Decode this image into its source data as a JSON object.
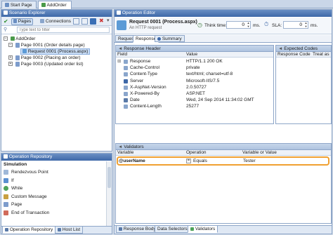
{
  "doc_tabs": [
    {
      "label": "Start Page"
    },
    {
      "label": "AddOrder"
    }
  ],
  "scenario": {
    "title": "Scenario Explorer",
    "pages_label": "Pages",
    "connections_label": "Connections",
    "filter_placeholder": "Type text to filter",
    "tree": {
      "root": "AddOrder",
      "page1": "Page 0001 (Order details page)",
      "request1": "Request 0001 (Process.aspx)",
      "page2": "Page 0002 (Placing an order)",
      "page3": "Page 0003 (Updated order list)"
    }
  },
  "repository": {
    "title": "Operation Repository",
    "group": "Simulation",
    "items": [
      "Rendezvous Point",
      "If",
      "While",
      "Custom Message",
      "Page",
      "End of Transaction"
    ],
    "tabs": [
      "Operation Repository",
      "Host List"
    ]
  },
  "editor": {
    "title": "Operation Editor",
    "request_title": "Request 0001 (Process.aspx)",
    "request_sub": "An HTTP request",
    "think_time_label": "Think time:",
    "think_time_value": "0",
    "think_unit": "ms.",
    "sla_label": "SLA:",
    "sla_value": "0",
    "sla_unit": "ms.",
    "tabs": {
      "request": "Request",
      "response": "Response",
      "summary": "Summary"
    }
  },
  "response_header": {
    "title": "Response Header",
    "col_field": "Field",
    "col_value": "Value",
    "rows": [
      {
        "field": "Response",
        "value": "HTTP/1.1 200 OK"
      },
      {
        "field": "Cache-Control",
        "value": "private"
      },
      {
        "field": "Content-Type",
        "value": "text/html; charset=utf-8"
      },
      {
        "field": "Server",
        "value": "Microsoft-IIS/7.5"
      },
      {
        "field": "X-AspNet-Version",
        "value": "2.0.50727"
      },
      {
        "field": "X-Powered-By",
        "value": "ASP.NET"
      },
      {
        "field": "Date",
        "value": "Wed, 24 Sep 2014 11:34:02 GMT"
      },
      {
        "field": "Content-Length",
        "value": "25277"
      }
    ]
  },
  "expected_codes": {
    "title": "Expected Codes",
    "col_code": "Response Code",
    "col_treat": "Treat as"
  },
  "validators": {
    "title": "Validators",
    "col_variable": "Variable",
    "col_operation": "Operation",
    "col_value": "Variable or Value",
    "row": {
      "variable": "@userName",
      "operation": "Equals",
      "value": "Tester"
    }
  },
  "bottom_tabs": [
    "Response Body",
    "Data Selectors",
    "Validators"
  ],
  "colors": {
    "panel_header": "#3e68a8",
    "highlight": "#f0a030",
    "selection": "#c8dcf5"
  }
}
